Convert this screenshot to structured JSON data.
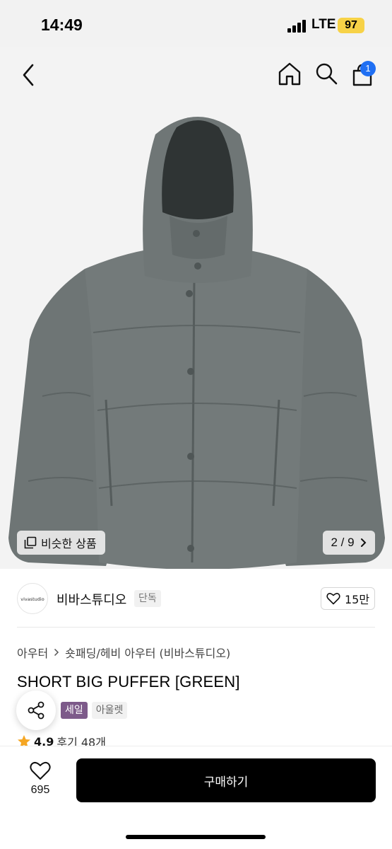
{
  "status_bar": {
    "time": "14:49",
    "network": "LTE",
    "battery": "97"
  },
  "nav": {
    "cart_count": "1",
    "icons": [
      "back-icon",
      "home-icon",
      "search-icon",
      "cart-icon"
    ]
  },
  "gallery": {
    "similar_label": "비슷한 상품",
    "current": "2",
    "separator": "/",
    "total": "9",
    "counter_text": "2 / 9"
  },
  "brand": {
    "logo_text": "vivastudio",
    "name": "비바스튜디오",
    "tag": "단독"
  },
  "like": {
    "count": "15만"
  },
  "breadcrumb": {
    "level1": "아우터",
    "level2": "숏패딩/헤비 아우터 (비바스튜디오)"
  },
  "product": {
    "title": "SHORT BIG PUFFER [GREEN]",
    "badge_sale": "세일",
    "badge_outlet": "아울렛",
    "rating": "4.9",
    "review_label": "후기 48개"
  },
  "bottom_bar": {
    "wish_count": "695",
    "buy_label": "구매하기"
  },
  "colors": {
    "accent_badge": "#1f6ff3",
    "sale_badge": "#7d5a8a",
    "buy_button": "#000000",
    "star": "#f5a623",
    "jacket": "#6b7272"
  }
}
